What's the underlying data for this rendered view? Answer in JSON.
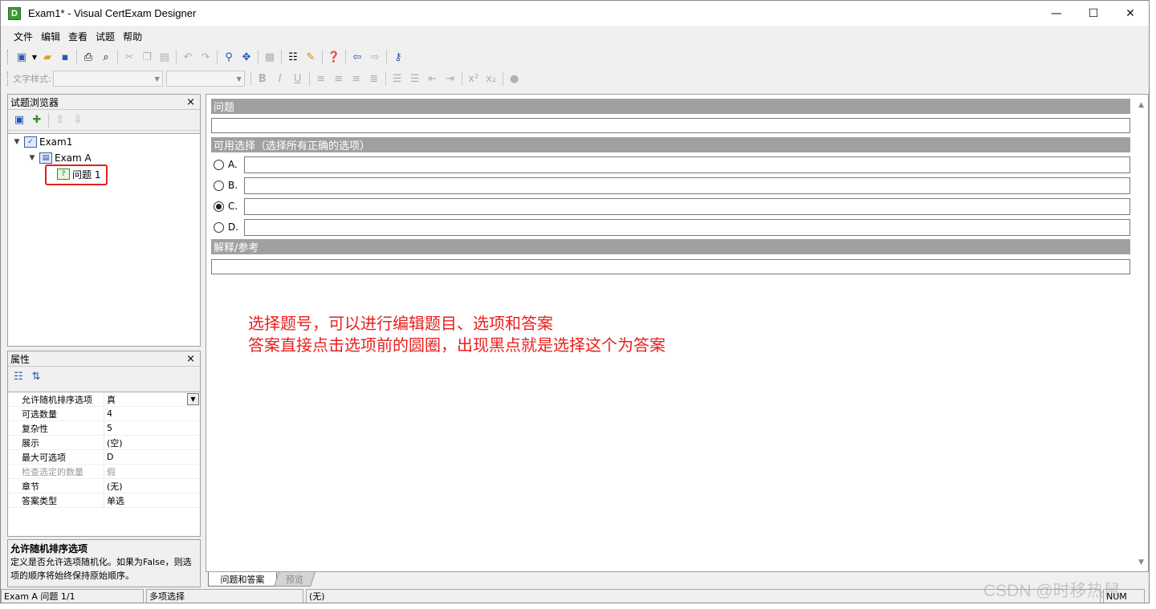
{
  "window": {
    "title": "Exam1* - Visual CertExam Designer",
    "app_icon_letter": "D",
    "controls": {
      "minimize": "—",
      "maximize": "☐",
      "close": "✕"
    }
  },
  "menu": [
    "文件",
    "编辑",
    "查看",
    "试题",
    "帮助"
  ],
  "toolbar_format": {
    "style_label": "文字样式:"
  },
  "explorer": {
    "title": "试题浏览器",
    "close": "×",
    "tree": {
      "root": "Exam1",
      "section": "Exam A",
      "question": "问题 1"
    }
  },
  "properties": {
    "title": "属性",
    "close": "×",
    "rows": [
      {
        "name": "允许随机排序选项",
        "value": "真",
        "dropdown": true
      },
      {
        "name": "可选数量",
        "value": "4"
      },
      {
        "name": "复杂性",
        "value": "5"
      },
      {
        "name": "展示",
        "value": "(空)"
      },
      {
        "name": "最大可选项",
        "value": "D"
      },
      {
        "name": "检查选定的数量",
        "value": "假",
        "disabled": true
      },
      {
        "name": "章节",
        "value": "(无)"
      },
      {
        "name": "答案类型",
        "value": "单选"
      }
    ],
    "description_title": "允许随机排序选项",
    "description_text": "定义是否允许选项随机化。如果为False，则选项的顺序将始终保持原始顺序。"
  },
  "editor": {
    "question_header": "问题",
    "choices_header": "可用选择（选择所有正确的选项）",
    "choices": [
      {
        "label": "A.",
        "checked": false
      },
      {
        "label": "B.",
        "checked": false
      },
      {
        "label": "C.",
        "checked": true
      },
      {
        "label": "D.",
        "checked": false
      }
    ],
    "explanation_header": "解释/参考",
    "annotation_line1": "选择题号，可以进行编辑题目、选项和答案",
    "annotation_line2": "答案直接点击选项前的圆圈，出现黑点就是选择这个为答案"
  },
  "tabs": {
    "qa": "问题和答案",
    "preview": "预览"
  },
  "status": {
    "location": "Exam A   问题 1/1",
    "type": "多项选择",
    "extra": "(无)",
    "num": "NUM"
  },
  "watermark": "CSDN @时移热鼠"
}
